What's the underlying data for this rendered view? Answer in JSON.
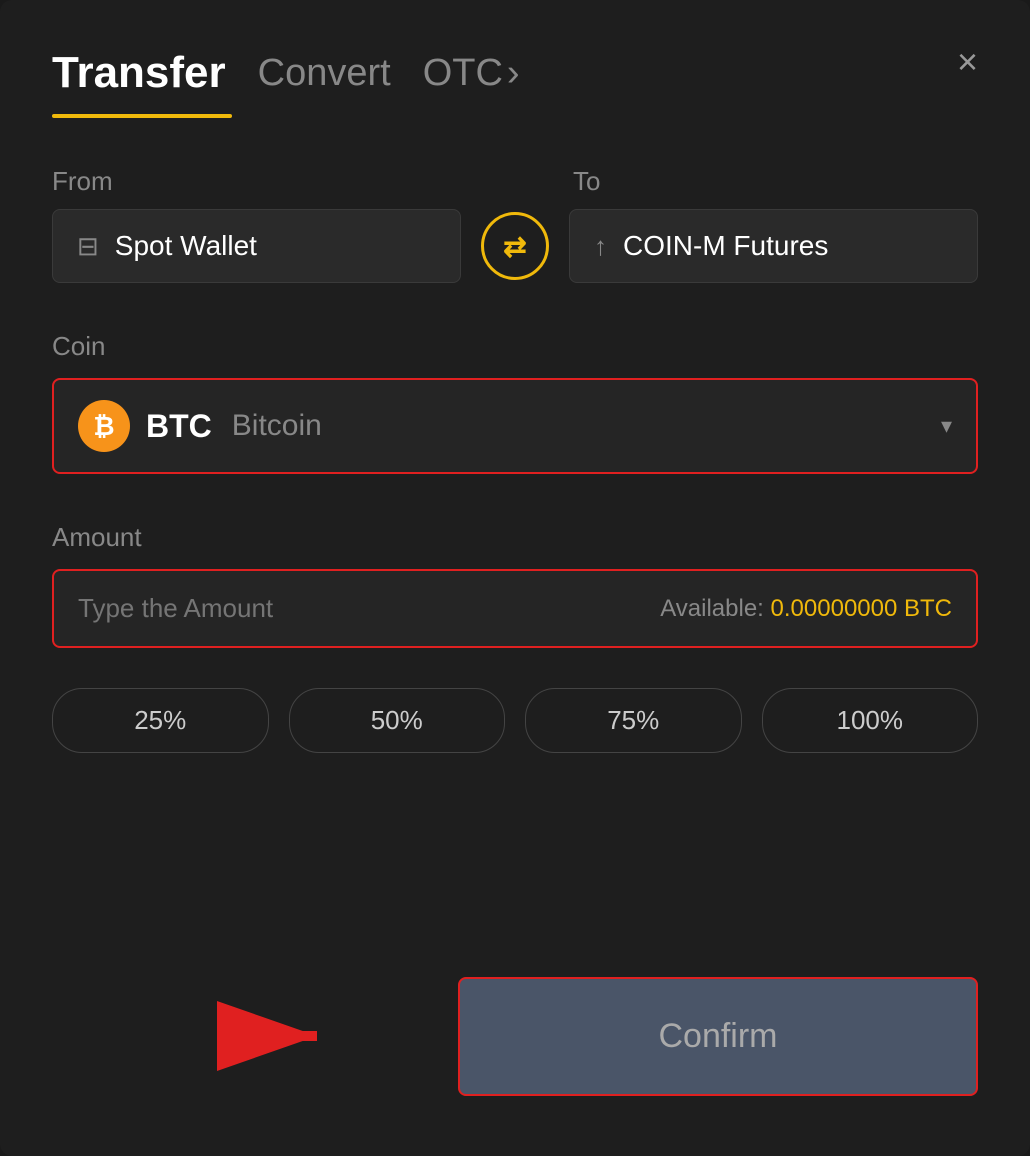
{
  "header": {
    "title": "Transfer",
    "tab_convert": "Convert",
    "tab_otc": "OTC",
    "close_label": "×"
  },
  "from_label": "From",
  "to_label": "To",
  "from_wallet": "Spot Wallet",
  "to_wallet": "COIN-M Futures",
  "coin_label": "Coin",
  "coin_symbol": "BTC",
  "coin_full_name": "Bitcoin",
  "amount_label": "Amount",
  "amount_placeholder": "Type the Amount",
  "available_label": "Available:",
  "available_value": "0.00000000 BTC",
  "percent_buttons": [
    "25%",
    "50%",
    "75%",
    "100%"
  ],
  "confirm_label": "Confirm",
  "icons": {
    "swap": "⇄",
    "close": "×",
    "chevron": "▾",
    "wallet": "💳",
    "futures": "↑"
  }
}
